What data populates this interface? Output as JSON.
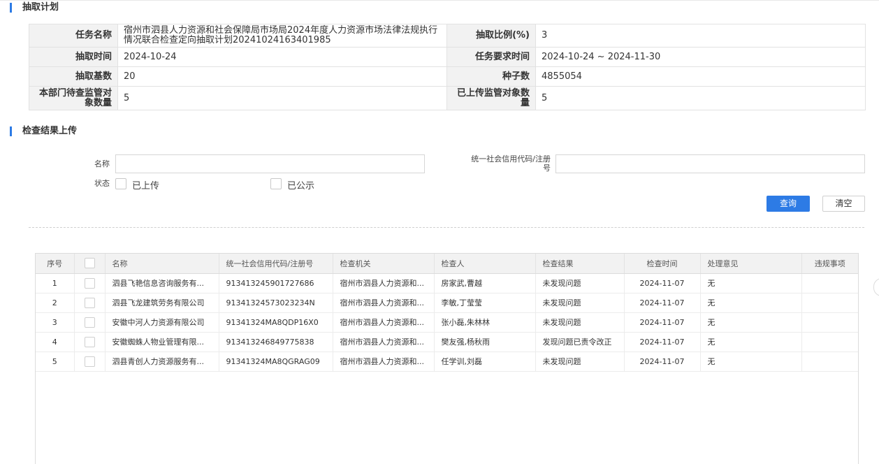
{
  "plan_section": {
    "title": "抽取计划",
    "task_name_label": "任务名称",
    "task_name": "宿州市泗县人力资源和社会保障局市场局2024年度人力资源市场法律法规执行情况联合检查定向抽取计划20241024163401985",
    "ratio_label": "抽取比例(%)",
    "ratio": "3",
    "extract_time_label": "抽取时间",
    "extract_time": "2024-10-24",
    "required_time_label": "任务要求时间",
    "required_time": "2024-10-24 ~ 2024-11-30",
    "base_label": "抽取基数",
    "base": "20",
    "seed_label": "种子数",
    "seed": "4855054",
    "pending_label": "本部门待查监管对象数量",
    "pending": "5",
    "uploaded_label": "已上传监管对象数量",
    "uploaded": "5"
  },
  "upload_section": {
    "title": "检查结果上传",
    "name_label": "名称",
    "name_value": "",
    "credit_code_label": "统一社会信用代码/注册号",
    "credit_code_value": "",
    "status_label": "状态",
    "status_uploaded": "已上传",
    "status_published": "已公示",
    "query_button": "查询",
    "clear_button": "清空"
  },
  "results_table": {
    "columns": [
      "序号",
      "",
      "名称",
      "统一社会信用代码/注册号",
      "检查机关",
      "检查人",
      "检查结果",
      "检查时间",
      "处理意见",
      "违规事项"
    ],
    "rows": [
      [
        "1",
        "",
        "泗县飞艳信息咨询服务有...",
        "913413245901727686",
        "宿州市泗县人力资源和...",
        "房家武,曹越",
        "未发现问题",
        "2024-11-07",
        "无",
        ""
      ],
      [
        "2",
        "",
        "泗县飞龙建筑劳务有限公司",
        "91341324573023234N",
        "宿州市泗县人力资源和...",
        "李敏,丁莹莹",
        "未发现问题",
        "2024-11-07",
        "无",
        ""
      ],
      [
        "3",
        "",
        "安徽中河人力资源有限公司",
        "91341324MA8QDP16X0",
        "宿州市泗县人力资源和...",
        "张小磊,朱林林",
        "未发现问题",
        "2024-11-07",
        "无",
        ""
      ],
      [
        "4",
        "",
        "安徽蜘蛛人物业管理有限...",
        "913413246849775838",
        "宿州市泗县人力资源和...",
        "樊友强,杨秋雨",
        "发现问题已责令改正",
        "2024-11-07",
        "无",
        ""
      ],
      [
        "5",
        "",
        "泗县青创人力资源服务有...",
        "91341324MA8QGRAG09",
        "宿州市泗县人力资源和...",
        "任学训,刘磊",
        "未发现问题",
        "2024-11-07",
        "无",
        ""
      ]
    ]
  },
  "colors": {
    "accent": "#2d7be5",
    "label_bg": "#f2f2f2",
    "border": "#e2e2e2"
  }
}
